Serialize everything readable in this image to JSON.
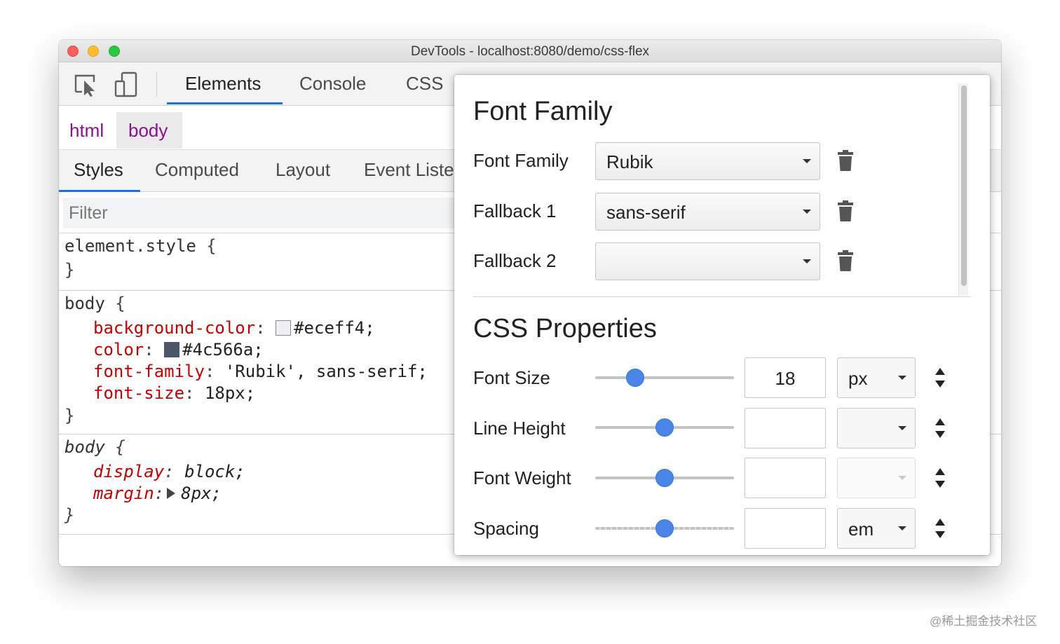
{
  "window": {
    "title": "DevTools - localhost:8080/demo/css-flex"
  },
  "toolbar": {
    "inspect_icon": "inspect-element-icon",
    "device_icon": "device-toolbar-icon",
    "tabs": [
      {
        "label": "Elements",
        "active": true
      },
      {
        "label": "Console",
        "active": false
      },
      {
        "label": "CSS",
        "active": false
      }
    ]
  },
  "breadcrumb": {
    "items": [
      "html",
      "body"
    ],
    "selected": "body"
  },
  "subtabs": [
    {
      "label": "Styles",
      "active": true
    },
    {
      "label": "Computed",
      "active": false
    },
    {
      "label": "Layout",
      "active": false
    },
    {
      "label": "Event Liste",
      "active": false
    }
  ],
  "filter": {
    "placeholder": "Filter",
    "value": ""
  },
  "rules": {
    "element_style": {
      "selector": "element.style",
      "open": "{",
      "close": "}"
    },
    "body_user": {
      "selector": "body",
      "open": "{",
      "close": "}",
      "declarations": [
        {
          "property": "background-color",
          "value": "#eceff4;",
          "swatch": "#eceff4"
        },
        {
          "property": "color",
          "value": "#4c566a;",
          "swatch": "#4c566a"
        },
        {
          "property": "font-family",
          "value": "'Rubik', sans-serif;"
        },
        {
          "property": "font-size",
          "value": "18px;"
        }
      ]
    },
    "body_agent": {
      "selector": "body",
      "open": "{",
      "close": "}",
      "declarations": [
        {
          "property": "display",
          "value": "block;"
        },
        {
          "property": "margin",
          "value": "8px;",
          "expandable": true
        }
      ]
    }
  },
  "font_editor": {
    "font_family_heading": "Font Family",
    "font_rows": [
      {
        "label": "Font Family",
        "value": "Rubik",
        "delete_icon": "trash-icon"
      },
      {
        "label": "Fallback 1",
        "value": "sans-serif",
        "delete_icon": "trash-icon"
      },
      {
        "label": "Fallback 2",
        "value": "",
        "delete_icon": "trash-icon"
      }
    ],
    "css_properties_heading": "CSS Properties",
    "property_rows": [
      {
        "label": "Font Size",
        "slider": 0.29,
        "value": "18",
        "unit": "px",
        "unit_disabled": false
      },
      {
        "label": "Line Height",
        "slider": 0.5,
        "value": "",
        "unit": "",
        "unit_disabled": false
      },
      {
        "label": "Font Weight",
        "slider": 0.5,
        "value": "",
        "unit": "",
        "unit_disabled": true
      },
      {
        "label": "Spacing",
        "slider": 0.5,
        "value": "",
        "unit": "em",
        "unit_disabled": false
      }
    ]
  },
  "watermark": "@稀土掘金技术社区",
  "colors": {
    "accent": "#1a73e8",
    "slider_thumb": "#4a86e8",
    "css_property": "#c80000",
    "breadcrumb": "#881391"
  }
}
